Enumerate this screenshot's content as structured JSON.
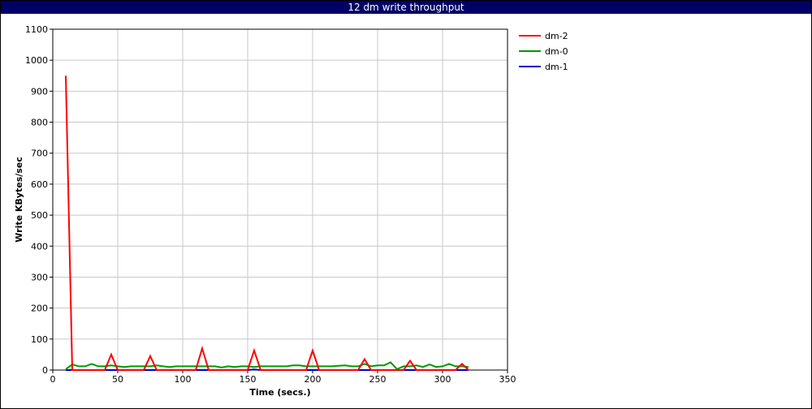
{
  "chart_data": {
    "type": "line",
    "title": "12 dm write throughput",
    "xlabel": "Time (secs.)",
    "ylabel": "Write KBytes/sec",
    "xlim": [
      0,
      350
    ],
    "ylim": [
      0,
      1100
    ],
    "xticks": [
      0,
      50,
      100,
      150,
      200,
      250,
      300,
      350
    ],
    "yticks": [
      0,
      100,
      200,
      300,
      400,
      500,
      600,
      700,
      800,
      900,
      1000,
      1100
    ],
    "grid": true,
    "legend_position": "top-right",
    "series": [
      {
        "name": "dm-2",
        "color": "#ff0000",
        "x": [
          10,
          15,
          20,
          25,
          30,
          35,
          40,
          45,
          50,
          55,
          60,
          65,
          70,
          75,
          80,
          85,
          90,
          95,
          100,
          105,
          110,
          115,
          120,
          125,
          130,
          135,
          140,
          145,
          150,
          155,
          160,
          165,
          170,
          175,
          180,
          185,
          190,
          195,
          200,
          205,
          210,
          215,
          220,
          225,
          230,
          235,
          240,
          245,
          250,
          255,
          260,
          265,
          270,
          275,
          280,
          285,
          290,
          295,
          300,
          305,
          310,
          315,
          320
        ],
        "y": [
          950,
          0,
          0,
          0,
          0,
          0,
          0,
          50,
          0,
          0,
          0,
          0,
          0,
          45,
          0,
          0,
          0,
          0,
          0,
          0,
          0,
          70,
          0,
          0,
          0,
          0,
          0,
          0,
          0,
          63,
          0,
          0,
          0,
          0,
          0,
          0,
          0,
          0,
          63,
          0,
          0,
          0,
          0,
          0,
          0,
          0,
          35,
          0,
          0,
          0,
          0,
          0,
          0,
          30,
          0,
          0,
          0,
          0,
          0,
          0,
          0,
          20,
          0
        ]
      },
      {
        "name": "dm-0",
        "color": "#009900",
        "x": [
          10,
          15,
          20,
          25,
          30,
          35,
          40,
          45,
          50,
          55,
          60,
          65,
          70,
          75,
          80,
          85,
          90,
          95,
          100,
          105,
          110,
          115,
          120,
          125,
          130,
          135,
          140,
          145,
          150,
          155,
          160,
          165,
          170,
          175,
          180,
          185,
          190,
          195,
          200,
          205,
          210,
          215,
          220,
          225,
          230,
          235,
          240,
          245,
          250,
          255,
          260,
          265,
          270,
          275,
          280,
          285,
          290,
          295,
          300,
          305,
          310,
          315,
          320
        ],
        "y": [
          3,
          18,
          12,
          12,
          20,
          12,
          12,
          15,
          12,
          10,
          12,
          12,
          12,
          12,
          15,
          12,
          10,
          12,
          12,
          12,
          12,
          12,
          12,
          12,
          8,
          12,
          10,
          12,
          12,
          10,
          12,
          12,
          12,
          12,
          12,
          15,
          15,
          12,
          12,
          12,
          12,
          12,
          14,
          15,
          12,
          12,
          20,
          12,
          15,
          15,
          25,
          3,
          12,
          12,
          15,
          10,
          18,
          10,
          12,
          20,
          12,
          12,
          10
        ]
      },
      {
        "name": "dm-1",
        "color": "#0000cc",
        "x": [
          10,
          15,
          20,
          25,
          30,
          35,
          40,
          45,
          50,
          55,
          60,
          65,
          70,
          75,
          80,
          85,
          90,
          95,
          100,
          105,
          110,
          115,
          120,
          125,
          130,
          135,
          140,
          145,
          150,
          155,
          160,
          165,
          170,
          175,
          180,
          185,
          190,
          195,
          200,
          205,
          210,
          215,
          220,
          225,
          230,
          235,
          240,
          245,
          250,
          255,
          260,
          265,
          270,
          275,
          280,
          285,
          290,
          295,
          300,
          305,
          310,
          315,
          320
        ],
        "y": [
          0,
          0,
          0,
          0,
          0,
          0,
          0,
          0,
          0,
          0,
          0,
          0,
          0,
          0,
          0,
          0,
          0,
          0,
          0,
          0,
          0,
          0,
          0,
          0,
          0,
          0,
          0,
          0,
          0,
          2,
          0,
          0,
          0,
          0,
          0,
          0,
          0,
          0,
          0,
          0,
          0,
          0,
          0,
          0,
          0,
          0,
          0,
          0,
          0,
          0,
          0,
          0,
          0,
          0,
          0,
          0,
          0,
          0,
          0,
          0,
          0,
          0,
          0
        ]
      }
    ]
  }
}
